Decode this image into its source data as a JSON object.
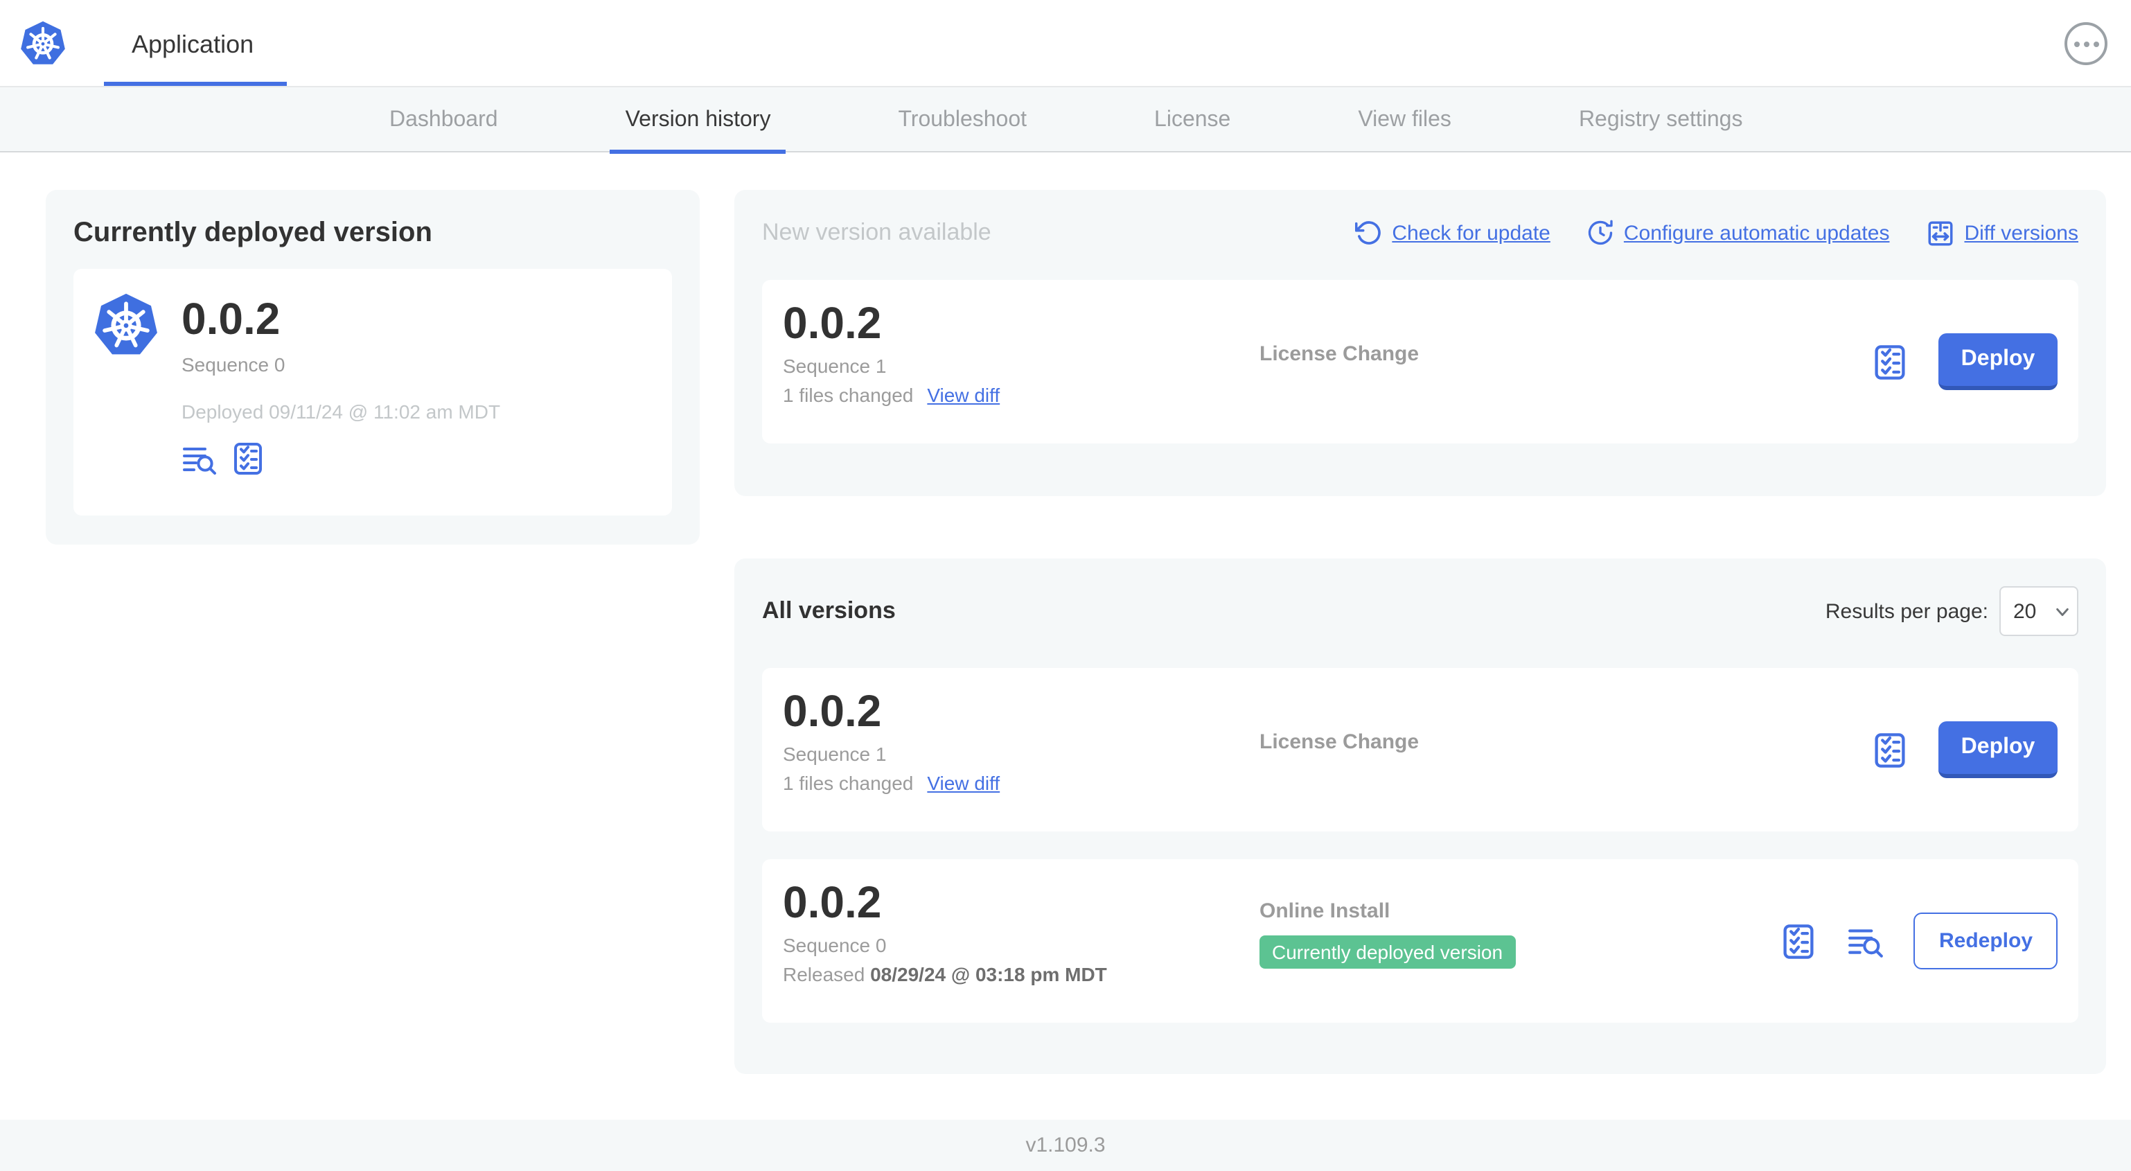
{
  "header": {
    "title": "Application"
  },
  "nav": {
    "tabs": [
      {
        "label": "Dashboard"
      },
      {
        "label": "Version history"
      },
      {
        "label": "Troubleshoot"
      },
      {
        "label": "License"
      },
      {
        "label": "View files"
      },
      {
        "label": "Registry settings"
      }
    ],
    "active_tab": "Version history"
  },
  "current_version": {
    "heading": "Currently deployed version",
    "version": "0.0.2",
    "sequence": "Sequence 0",
    "deployed": "Deployed 09/11/24 @ 11:02 am MDT",
    "icons": [
      "logs-icon",
      "checklist-icon"
    ]
  },
  "new_version": {
    "heading": "New version available",
    "links": [
      {
        "icon": "refresh-icon",
        "label": "Check for update"
      },
      {
        "icon": "clock-refresh-icon",
        "label": "Configure automatic updates"
      },
      {
        "icon": "diff-icon",
        "label": "Diff versions"
      }
    ],
    "card": {
      "version": "0.0.2",
      "sequence": "Sequence 1",
      "files_changed": "1 files changed",
      "view_diff": "View diff",
      "source": "License Change",
      "action": "Deploy"
    }
  },
  "all_versions": {
    "heading": "All versions",
    "results_per_page_label": "Results per page:",
    "results_per_page_value": "20",
    "rows": [
      {
        "version": "0.0.2",
        "sequence": "Sequence 1",
        "files_changed": "1 files changed",
        "view_diff": "View diff",
        "source": "License Change",
        "action": "Deploy"
      },
      {
        "version": "0.0.2",
        "sequence": "Sequence 0",
        "released_prefix": "Released",
        "released_date": "08/29/24 @ 03:18 pm MDT",
        "source": "Online Install",
        "badge": "Currently deployed version",
        "action": "Redeploy"
      }
    ]
  },
  "footer": {
    "version": "v1.109.3"
  },
  "colors": {
    "accent_blue": "#4470E3",
    "k8s_blue": "#3F6FE0",
    "badge_green": "#5CC392",
    "panel_bg": "#F5F8F9",
    "text_dark": "#323232",
    "text_gray": "#9B9B9B",
    "text_light": "#C3C7C9"
  }
}
